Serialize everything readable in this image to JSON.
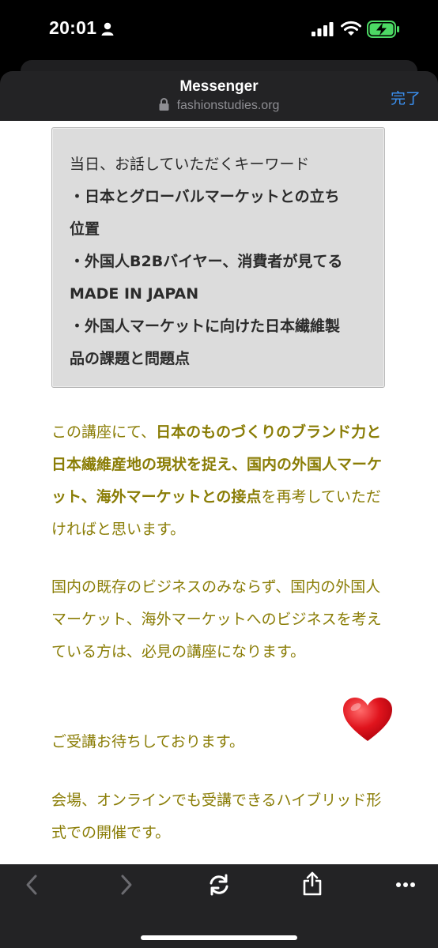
{
  "status_bar": {
    "time": "20:01"
  },
  "header": {
    "title": "Messenger",
    "url": "fashionstudies.org",
    "done_label": "完了"
  },
  "keywords": {
    "intro": "当日、お話していただくキーワード",
    "items": [
      "・日本とグローバルマーケットとの立ち",
      "位置",
      "・外国人B2Bバイヤー、消費者が見てる",
      "MADE IN JAPAN",
      "・外国人マーケットに向けた日本繊維製",
      "品の課題と問題点"
    ]
  },
  "paragraph1": {
    "lead": "この講座にて、",
    "bold": "日本のものづくりのブランド力と日本繊維産地の現状を捉え、国内の外国人マーケット、海外マーケットとの接点",
    "tail": "を再考していただければと思います。"
  },
  "paragraph2": "国内の既存のビジネスのみならず、国内の外国人マーケット、海外マーケットへのビジネスを考えている方は、必見の講座になります。",
  "paragraph3": "ご受講お待ちしております。",
  "paragraph4": "会場、オンラインでも受講できるハイブリッド形式での開催です。",
  "colors": {
    "accent_olive": "#8a7d06",
    "link_blue": "#3b93f7",
    "battery_green": "#4cd964",
    "heart_red": "#e0141d"
  },
  "icons": [
    "person-icon",
    "signal-icon",
    "wifi-icon",
    "battery-charging-icon",
    "lock-icon",
    "heart-icon",
    "back-arrow-icon",
    "forward-arrow-icon",
    "reload-icon",
    "share-icon",
    "more-icon"
  ]
}
